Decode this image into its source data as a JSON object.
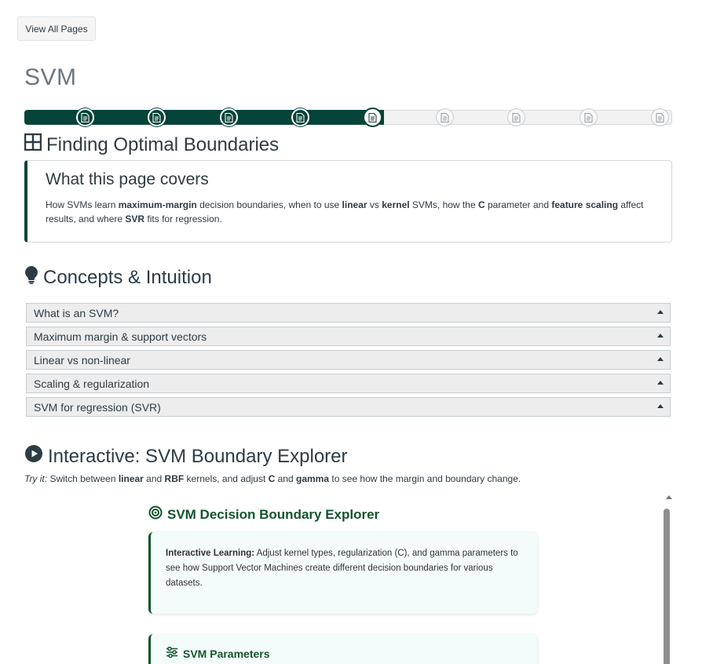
{
  "nav": {
    "view_all_label": "View All Pages"
  },
  "page": {
    "title": "SVM"
  },
  "progress": {
    "total_steps": 9,
    "completed_steps": 4,
    "current_step": 5,
    "fill_fraction": 0.555,
    "accent": "#06443a"
  },
  "section1": {
    "title": "Finding Optimal Boundaries",
    "icon": "grid-icon"
  },
  "covers": {
    "title": "What this page covers",
    "parts": [
      {
        "t": "How SVMs learn ",
        "b": false
      },
      {
        "t": "maximum-margin",
        "b": true
      },
      {
        "t": " decision boundaries, when to use ",
        "b": false
      },
      {
        "t": "linear",
        "b": true
      },
      {
        "t": " vs ",
        "b": false
      },
      {
        "t": "kernel",
        "b": true
      },
      {
        "t": " SVMs, how the ",
        "b": false
      },
      {
        "t": "C",
        "b": true
      },
      {
        "t": " parameter and ",
        "b": false
      },
      {
        "t": "feature scaling",
        "b": true
      },
      {
        "t": " affect results, and where ",
        "b": false
      },
      {
        "t": "SVR",
        "b": true
      },
      {
        "t": " fits for regression.",
        "b": false
      }
    ]
  },
  "section2": {
    "title": "Concepts & Intuition",
    "icon": "lightbulb-icon"
  },
  "accordion": [
    "What is an SVM?",
    "Maximum margin & support vectors",
    "Linear vs non-linear",
    "Scaling & regularization",
    "SVM for regression (SVR)"
  ],
  "section3": {
    "title": "Interactive: SVM Boundary Explorer",
    "icon": "play-circle-icon"
  },
  "tryit": {
    "parts": [
      {
        "t": "Try it:",
        "i": true
      },
      {
        "t": " Switch between ",
        "b": false
      },
      {
        "t": "linear",
        "b": true
      },
      {
        "t": " and ",
        "b": false
      },
      {
        "t": "RBF",
        "b": true
      },
      {
        "t": " kernels, and adjust ",
        "b": false
      },
      {
        "t": "C",
        "b": true
      },
      {
        "t": " and ",
        "b": false
      },
      {
        "t": "gamma",
        "b": true
      },
      {
        "t": " to see how the margin and boundary change.",
        "b": false
      }
    ]
  },
  "explorer": {
    "title": "SVM Decision Boundary Explorer",
    "icon": "target-icon",
    "info_label": "Interactive Learning:",
    "info_text": " Adjust kernel types, regularization (C), and gamma parameters to see how Support Vector Machines create different decision boundaries for various datasets.",
    "params_title": "SVM Parameters",
    "params_icon": "sliders-icon",
    "accent": "#14532d"
  }
}
